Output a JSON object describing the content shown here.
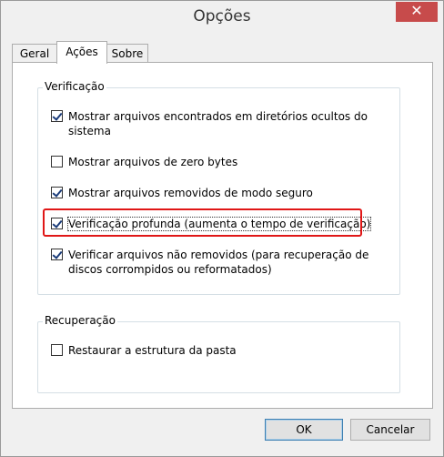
{
  "window": {
    "title": "Opções",
    "close_glyph": "✕"
  },
  "tabs": [
    {
      "label": "Geral",
      "active": false
    },
    {
      "label": "Ações",
      "active": true
    },
    {
      "label": "Sobre",
      "active": false
    }
  ],
  "verification": {
    "title": "Verificação",
    "options": [
      {
        "label": "Mostrar arquivos encontrados em diretórios ocultos do sistema",
        "checked": true
      },
      {
        "label": "Mostrar arquivos de zero bytes",
        "checked": false
      },
      {
        "label": "Mostrar arquivos removidos de modo seguro",
        "checked": true
      },
      {
        "label": "Verificação profunda (aumenta o tempo de verificação)",
        "checked": true
      },
      {
        "label": "Verificar arquivos não removidos (para recuperação de discos corrompidos ou reformatados)",
        "checked": true
      }
    ]
  },
  "recovery": {
    "title": "Recuperação",
    "options": [
      {
        "label": "Restaurar a estrutura da pasta",
        "checked": false
      }
    ]
  },
  "buttons": {
    "ok": "OK",
    "cancel": "Cancelar"
  },
  "colors": {
    "highlight": "#e01717",
    "close_button": "#c74b4b"
  }
}
